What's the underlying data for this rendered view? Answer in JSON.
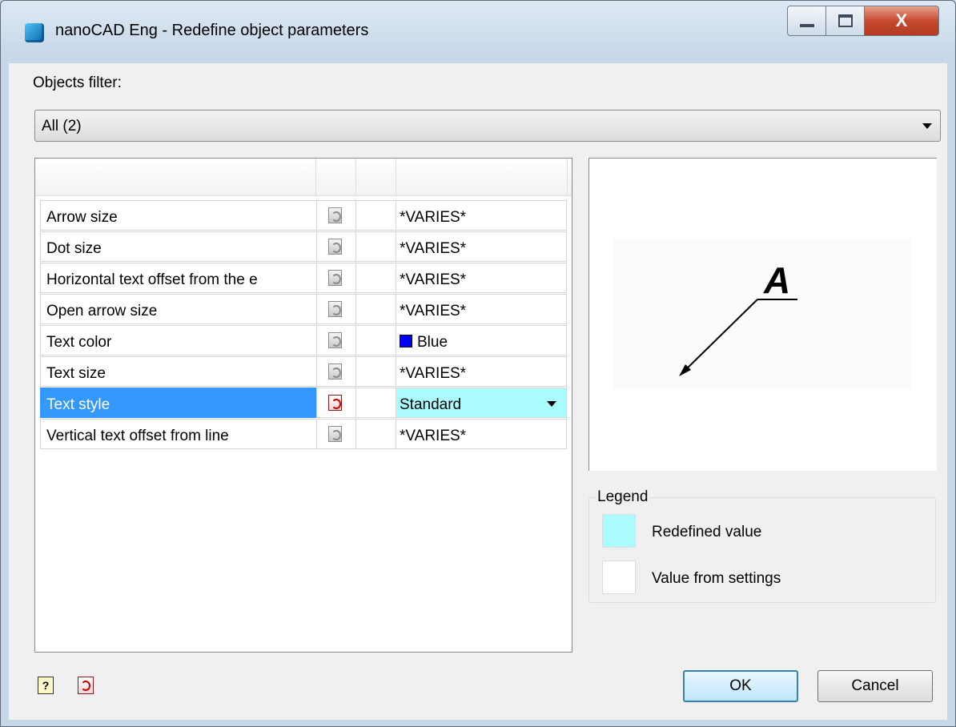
{
  "window": {
    "title": "nanoCAD Eng - Redefine object parameters",
    "close_glyph": "X"
  },
  "filter": {
    "label": "Objects filter:",
    "value": "All (2)"
  },
  "grid": {
    "rows": [
      {
        "name": "Arrow size",
        "value": "*VARIES*"
      },
      {
        "name": "Dot size",
        "value": "*VARIES*"
      },
      {
        "name": "Horizontal text offset from the e",
        "value": "*VARIES*"
      },
      {
        "name": "Open arrow size",
        "value": "*VARIES*"
      },
      {
        "name": "Text color",
        "value": "Blue",
        "swatch_color": "#0000ff"
      },
      {
        "name": "Text size",
        "value": "*VARIES*"
      },
      {
        "name": "Text style",
        "value": "Standard",
        "selected": true
      },
      {
        "name": "Vertical text offset from line",
        "value": "*VARIES*"
      }
    ]
  },
  "preview": {
    "letter": "A"
  },
  "legend": {
    "title": "Legend",
    "redefined": {
      "label": "Redefined value",
      "color": "#aafcff"
    },
    "settings": {
      "label": "Value from settings",
      "color": "#ffffff"
    }
  },
  "buttons": {
    "ok": "OK",
    "cancel": "Cancel",
    "help_glyph": "?"
  },
  "colors": {
    "selection": "#3399ff",
    "redefined_cell": "#aafcff"
  }
}
